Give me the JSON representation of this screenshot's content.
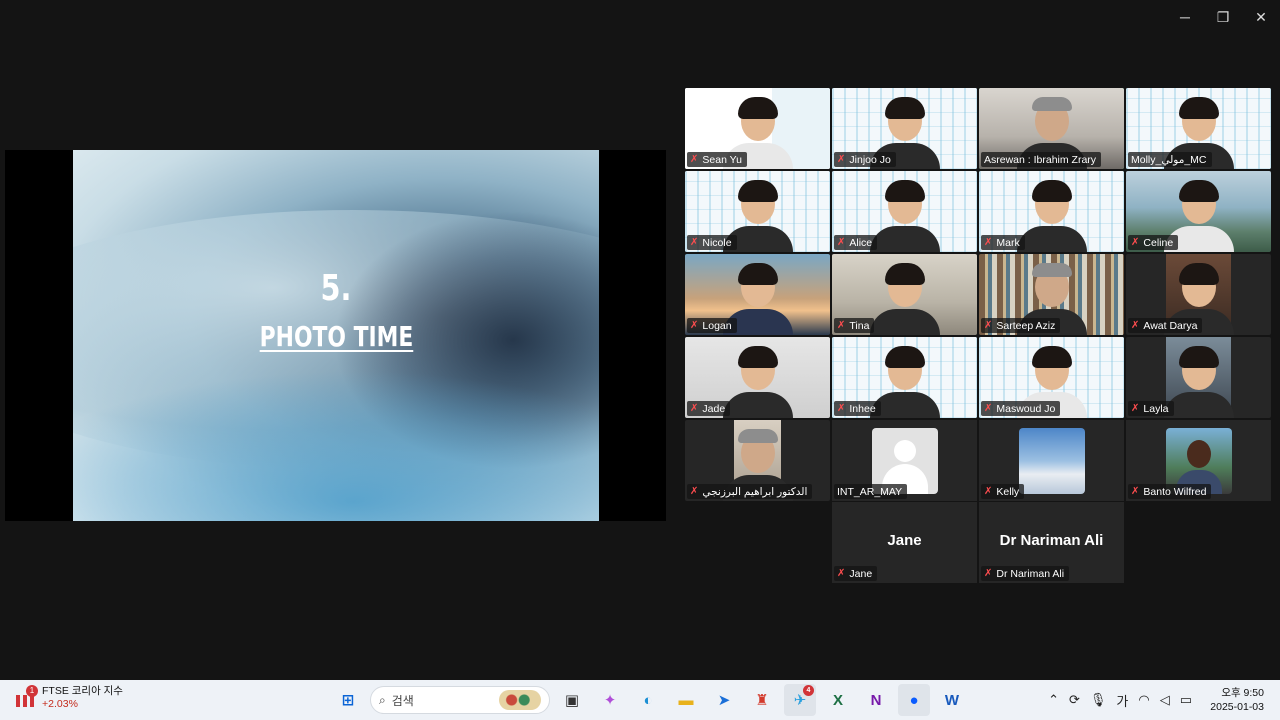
{
  "window": {
    "controls": [
      {
        "name": "minimize-button",
        "glyph": "─"
      },
      {
        "name": "restore-button",
        "glyph": "❐"
      },
      {
        "name": "close-button",
        "glyph": "✕"
      }
    ]
  },
  "slide": {
    "number": "5.",
    "title": "PHOTO TIME"
  },
  "participants": [
    {
      "name": "Sean Yu"
    },
    {
      "name": "Jinjoo Jo"
    },
    {
      "name": "Asrewan : Ibrahim Zrary"
    },
    {
      "name": "Molly_مولي_MC"
    },
    {
      "name": "Nicole"
    },
    {
      "name": "Alice"
    },
    {
      "name": "Mark"
    },
    {
      "name": "Celine"
    },
    {
      "name": "Logan"
    },
    {
      "name": "Tina"
    },
    {
      "name": "Sarteep Aziz"
    },
    {
      "name": "Awat Darya"
    },
    {
      "name": "Jade"
    },
    {
      "name": "Inhee"
    },
    {
      "name": "Maswoud Jo"
    },
    {
      "name": "Layla"
    },
    {
      "name": "الدكتور ابراهيم البرزنجي"
    },
    {
      "name": "INT_AR_MAY"
    },
    {
      "name": "Kelly"
    },
    {
      "name": "Banto Wilfred"
    },
    {
      "name": "Jane",
      "display": "Jane"
    },
    {
      "name": "Dr Nariman Ali",
      "display": "Dr Nariman Ali"
    }
  ],
  "taskbar": {
    "widget_title": "FTSE 코리아 지수",
    "widget_change": "+2.03%",
    "widget_badge": "1",
    "search_placeholder": "검색",
    "telegram_badge": "4",
    "apps": [
      "start-icon",
      "search",
      "task-view-icon",
      "copilot-icon",
      "edge-icon",
      "file-explorer-icon",
      "arrow-app-icon",
      "robot-app-icon",
      "telegram-icon",
      "excel-icon",
      "onenote-icon",
      "zoom-icon",
      "word-icon"
    ],
    "ime": "가",
    "time": "오후 9:50",
    "date": "2025-01-03"
  },
  "colors": {
    "active_speaker": "#3ddc84",
    "muted": "#ff4d4f",
    "taskbar_bg": "#eef2f7"
  }
}
